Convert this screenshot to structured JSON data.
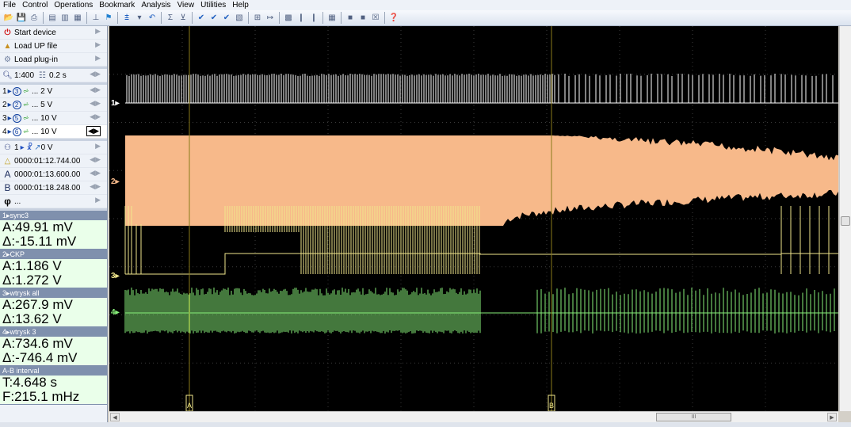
{
  "menu": [
    "File",
    "Control",
    "Operations",
    "Bookmark",
    "Analysis",
    "View",
    "Utilities",
    "Help"
  ],
  "toolbar_icons": [
    "open-icon",
    "save-icon",
    "print-icon",
    "sep",
    "layout-1-icon",
    "layout-2-icon",
    "layout-3-icon",
    "sep",
    "cursor-icon",
    "flag-icon",
    "sep",
    "trigger-icon",
    "trigger-dd-icon",
    "undo-icon",
    "sep",
    "math-icon",
    "filter-icon",
    "sep",
    "check-icon",
    "check2-icon",
    "check3-icon",
    "doc-icon",
    "sep",
    "grid-icon",
    "export-icon",
    "sep",
    "scan-icon",
    "bars-icon",
    "bars2-icon",
    "sep",
    "chart-icon",
    "sep",
    "sq1-icon",
    "sq2-icon",
    "x-icon",
    "sep",
    "help-icon"
  ],
  "sidebar": {
    "start_device": "Start device",
    "load_up_file": "Load UP file",
    "load_plugin": "Load plug-in",
    "zoom": "1:400",
    "time_div": "0.2 s",
    "channels": [
      {
        "num": "1",
        "probe": "3",
        "scale": "... 2 V"
      },
      {
        "num": "2",
        "probe": "2",
        "scale": "... 5 V"
      },
      {
        "num": "3",
        "probe": "5",
        "scale": "... 10 V"
      },
      {
        "num": "4",
        "probe": "6",
        "scale": "... 10 V"
      }
    ],
    "trigger": "1",
    "trigger_level": "0 V",
    "trigger_time": "0000:01:12.744.00",
    "cursor_a": "0000:01:13.600.00",
    "cursor_b": "0000:01:18.248.00",
    "phi": "..."
  },
  "measurements": [
    {
      "header": "1▸sync3",
      "a": "A:49.91 mV",
      "d": "Δ:-15.11 mV"
    },
    {
      "header": "2▸CKP",
      "a": "A:1.186 V",
      "d": "Δ:1.272 V"
    },
    {
      "header": "3▸wtrysk all",
      "a": "A:267.9 mV",
      "d": "Δ:13.62 V"
    },
    {
      "header": "4▸wtrysk 3",
      "a": "A:734.6 mV",
      "d": "Δ:-746.4 mV"
    },
    {
      "header": "A-B interval",
      "a": "T:4.648 s",
      "d": "F:215.1 mHz"
    }
  ],
  "plot": {
    "channel_labels": [
      "1▸",
      "2▸",
      "3▸",
      "4▸"
    ],
    "colors": {
      "ch1": "#ffffff",
      "ch2": "#f7b98a",
      "ch3": "#f0e68c",
      "ch4": "#88f07a",
      "cursor": "#8a7a1a",
      "grid": "#3a3a3a"
    },
    "cursor_a_label": "A",
    "cursor_b_label": "B"
  },
  "hscroll_thumb": "III"
}
